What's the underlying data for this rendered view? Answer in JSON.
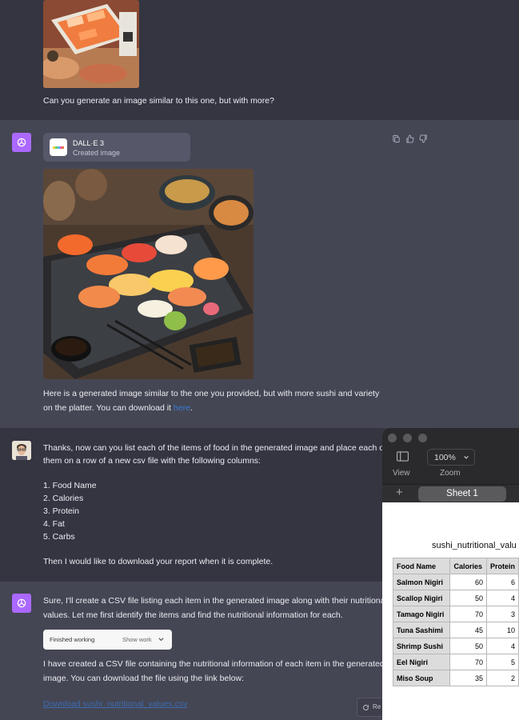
{
  "user_message_1": {
    "text": "Can you generate an image similar to this one, but with more?"
  },
  "assistant_message_1": {
    "tool_card": {
      "title": "DALL·E 3",
      "subtitle": "Created image"
    },
    "text_line1": "Here is a generated image similar to the one you provided, but with more sushi and variety",
    "text_line2_a": "on the platter. You can download it ",
    "text_line2_link": "here",
    "text_line2_b": "."
  },
  "user_message_2": {
    "line1": "Thanks, now can you list each of the items of food in the generated image and place each of",
    "line2": "them on a row of a new csv file with the following columns:",
    "columns": [
      "1. Food Name",
      "2. Calories",
      "3. Protein",
      "4. Fat",
      "5. Carbs"
    ],
    "closing": "Then I would like to download your report when it is complete."
  },
  "assistant_message_2": {
    "line1": "Sure, I'll create a CSV file listing each item in the generated image along with their nutritional",
    "line2": "values. Let me first identify the items and find the nutritional information for each.",
    "worked_label": "Finished working",
    "show_work_label": "Show work",
    "line3": "I have created a CSV file containing the nutritional information of each item in the generated",
    "line4": "image. You can download the file using the link below:",
    "download_link": "Download sushi_nutritional_values.csv",
    "regen_label": "Re"
  },
  "numbers_window": {
    "zoom_value": "100%",
    "view_label": "View",
    "zoom_label": "Zoom",
    "plus": "+",
    "sheet_tab": "Sheet 1",
    "table_title": "sushi_nutritional_valu",
    "headers": [
      "Food Name",
      "Calories",
      "Protein"
    ],
    "rows": [
      {
        "name": "Salmon Nigiri",
        "calories": "60",
        "protein": "6"
      },
      {
        "name": "Scallop Nigiri",
        "calories": "50",
        "protein": "4"
      },
      {
        "name": "Tamago Nigiri",
        "calories": "70",
        "protein": "3"
      },
      {
        "name": "Tuna Sashimi",
        "calories": "45",
        "protein": "10"
      },
      {
        "name": "Shrimp Sushi",
        "calories": "50",
        "protein": "4"
      },
      {
        "name": "Eel Nigiri",
        "calories": "70",
        "protein": "5"
      },
      {
        "name": "Miso Soup",
        "calories": "35",
        "protein": "2"
      }
    ]
  },
  "colors": {
    "user_bg": "#343541",
    "assistant_bg": "#444654",
    "assistant_avatar": "#ab68ff",
    "link": "#3b7bd8"
  }
}
